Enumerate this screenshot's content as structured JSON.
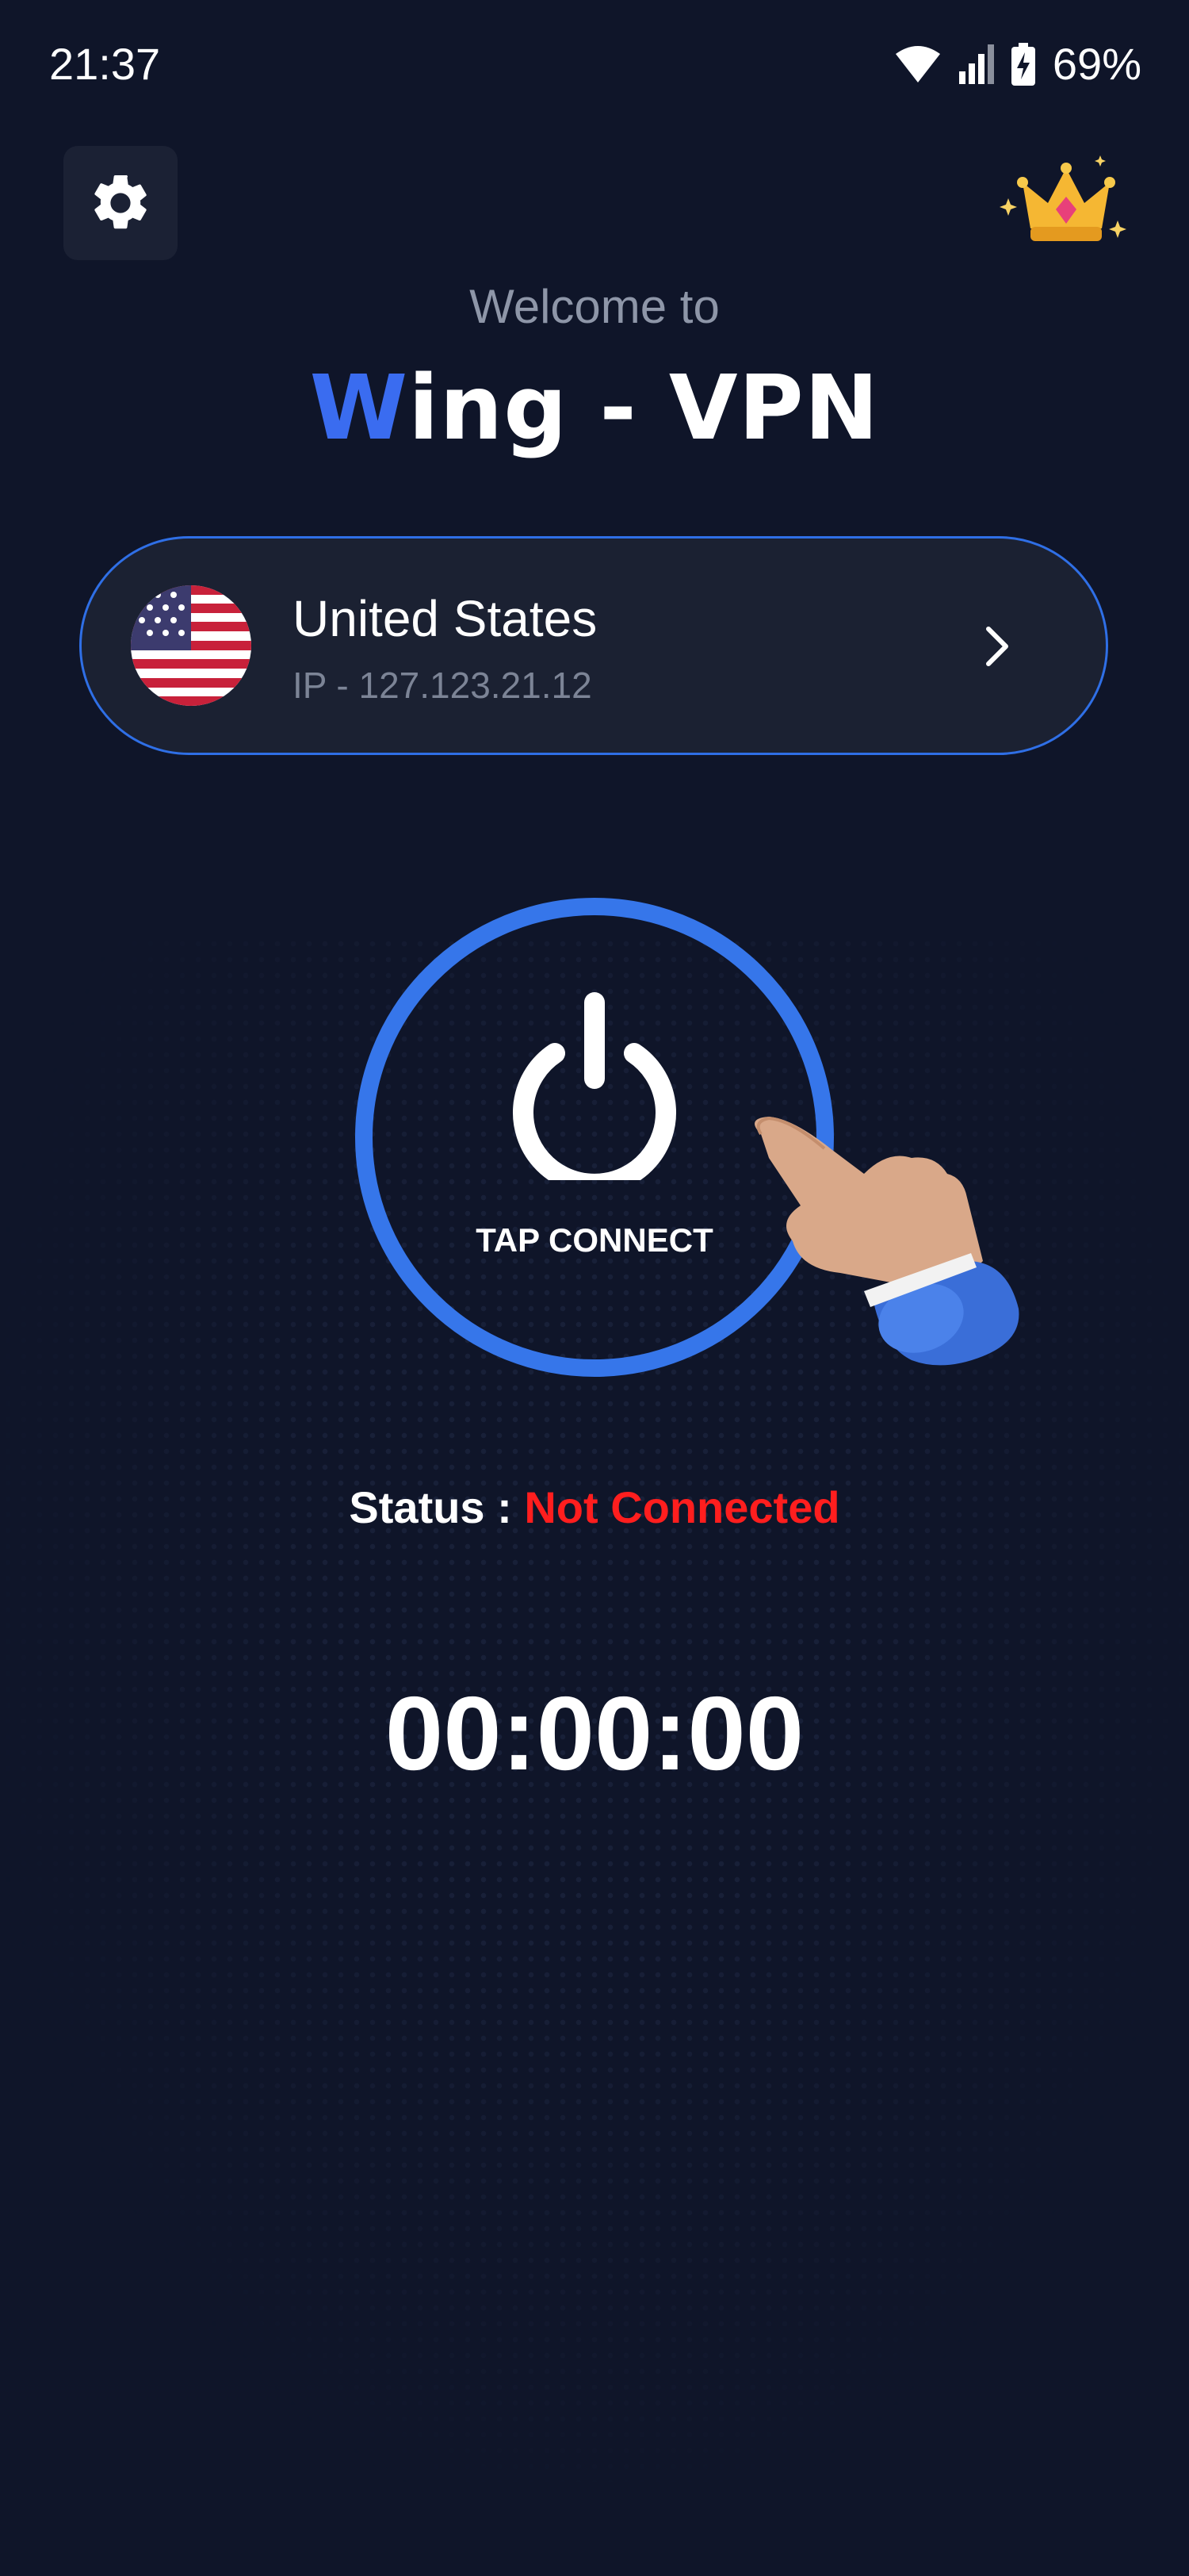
{
  "status_bar": {
    "time": "21:37",
    "battery_percent": "69%",
    "icons": [
      "wifi-icon",
      "signal-icon",
      "battery-charging-icon"
    ]
  },
  "header": {
    "settings_icon": "gear-icon",
    "premium_icon": "crown-icon",
    "welcome": "Welcome to",
    "title_accent": "W",
    "title_rest": "ing - VPN"
  },
  "server": {
    "country": "United States",
    "ip": "IP - 127.123.21.12",
    "flag_icon": "us-flag-icon",
    "chevron_icon": "chevron-right-icon"
  },
  "connect": {
    "label": "TAP CONNECT",
    "icon": "power-icon"
  },
  "status": {
    "label": "Status : ",
    "value": "Not Connected"
  },
  "timer": "00:00:00",
  "colors": {
    "background": "#0f1529",
    "accent": "#3676ea",
    "status_error": "#ff1e1e",
    "muted_text": "#8e96a8"
  }
}
